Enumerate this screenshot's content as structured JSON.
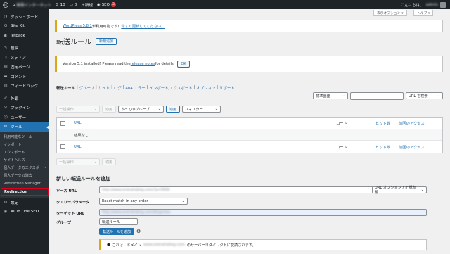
{
  "adminbar": {
    "site_name": "無限インターネット",
    "updates": "10",
    "comments": "0",
    "new": "＋新規",
    "seo": "SEO",
    "seo_count": "3",
    "greeting": "こんにちは、",
    "user_name": "admin"
  },
  "sidebar": {
    "items": [
      {
        "label": "ダッシュボード",
        "icon": "dashboard-icon"
      },
      {
        "label": "Site Kit",
        "icon": "sitekit-icon"
      },
      {
        "label": "Jetpack",
        "icon": "jetpack-icon"
      },
      {
        "label": "投稿",
        "icon": "pin-icon"
      },
      {
        "label": "メディア",
        "icon": "media-icon"
      },
      {
        "label": "固定ページ",
        "icon": "page-icon"
      },
      {
        "label": "コメント",
        "icon": "comment-icon"
      },
      {
        "label": "フィードバック",
        "icon": "feedback-icon"
      },
      {
        "label": "外観",
        "icon": "brush-icon"
      },
      {
        "label": "プラグイン",
        "icon": "plugin-icon"
      },
      {
        "label": "ユーザー",
        "icon": "user-icon"
      },
      {
        "label": "ツール",
        "icon": "wrench-icon"
      }
    ],
    "submenu": [
      "利用可能なツール",
      "インポート",
      "エクスポート",
      "サイトヘルス",
      "個人データのエクスポート",
      "個人データの消去",
      "Redirection Manager",
      "Redirection"
    ],
    "after": [
      {
        "label": "設定",
        "icon": "settings-icon"
      },
      {
        "label": "All in One SEO",
        "icon": "aioseo-icon"
      }
    ]
  },
  "screen_options": "表示オプション ▾",
  "help": "ヘルプ ▾",
  "update_notice": {
    "link": "WordPress 5.8.1",
    "text": " が利用可能です！",
    "link2": "今すぐ更新してください。"
  },
  "page_title": "転送ルール",
  "add_new": "新規追加",
  "install_notice": {
    "pre": "Version 5.1 installed! Please read the ",
    "link": "release notes",
    "post": " for details.",
    "ok": "OK"
  },
  "subnav": {
    "current": "転送ルール",
    "links": [
      "グループ",
      "サイト",
      "ログ",
      "404 エラー",
      "インポート/エクスポート",
      "オプション",
      "サポート"
    ]
  },
  "search": {
    "mode": "標準画面",
    "value": "",
    "button": "URL を検索"
  },
  "bulk": {
    "action": "一括操作",
    "apply": "適用",
    "group_filter": "すべてのグループ",
    "apply2": "適用",
    "filter": "フィルター"
  },
  "table": {
    "col_url": "URL",
    "col_code": "コード",
    "col_hits": "ヒット数",
    "col_last": "前回のアクセス",
    "empty": "結果なし"
  },
  "add_form": {
    "heading": "新しい転送ルールを追加",
    "source_label": "ソース URL",
    "source_value": "http://www.onenetsblog.com/?p=9999",
    "url_options": "URL オプション / 正規表現",
    "query_label": "クエリーパラメータ",
    "query_value": "Exact match in any order",
    "target_label": "ターゲット URL",
    "target_value": "http://www.onenetsblog.com/blognews",
    "group_label": "グループ",
    "group_value": "転送ルール",
    "submit": "転送ルールを追加",
    "info_pre": "これは、ドメイン",
    "info_domain": "www.onenetsblog.com",
    "info_post": "のサーバーリダイレクトに変換されます。"
  }
}
